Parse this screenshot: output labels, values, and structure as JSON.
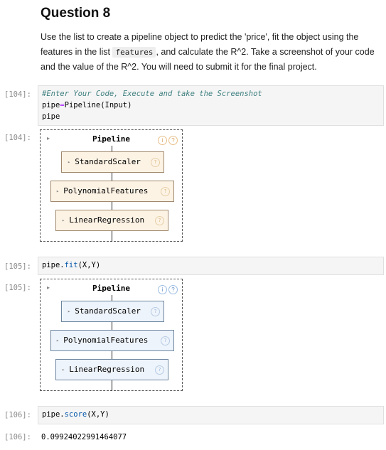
{
  "heading": "Question 8",
  "instructions": {
    "text_before": "Use the list to create a pipeline object to predict the 'price', fit the object using the features in the list ",
    "code_word": "features",
    "text_after": ", and calculate the R^2. Take a screenshot of your code and the value of the R^2. You will need to submit it for the final project."
  },
  "cells": {
    "c1": {
      "in_prompt": "[104]:",
      "comment": "#Enter Your Code, Execute and take the Screenshot",
      "line2_a": "pipe",
      "line2_op": "=",
      "line2_b": "Pipeline(Input)",
      "line3": "pipe",
      "out_prompt": "[104]:"
    },
    "c2": {
      "in_prompt": "[105]:",
      "obj": "pipe.",
      "method": "fit",
      "args": "(X,Y)",
      "out_prompt": "[105]:"
    },
    "c3": {
      "in_prompt": "[106]:",
      "obj": "pipe.",
      "method": "score",
      "args": "(X,Y)",
      "out_prompt": "[106]:",
      "result": "0.09924022991464077"
    }
  },
  "pipeline": {
    "title": "Pipeline",
    "info_glyph": "i",
    "help_glyph": "?",
    "collapse_glyph": "▸",
    "steps": [
      "StandardScaler",
      "PolynomialFeatures",
      "LinearRegression"
    ]
  },
  "colors": {
    "unfitted_fill": "#fdf3e5",
    "fitted_fill": "#eef4fb",
    "unfitted_icon": "#e8a23a",
    "fitted_icon": "#4a84c8"
  }
}
